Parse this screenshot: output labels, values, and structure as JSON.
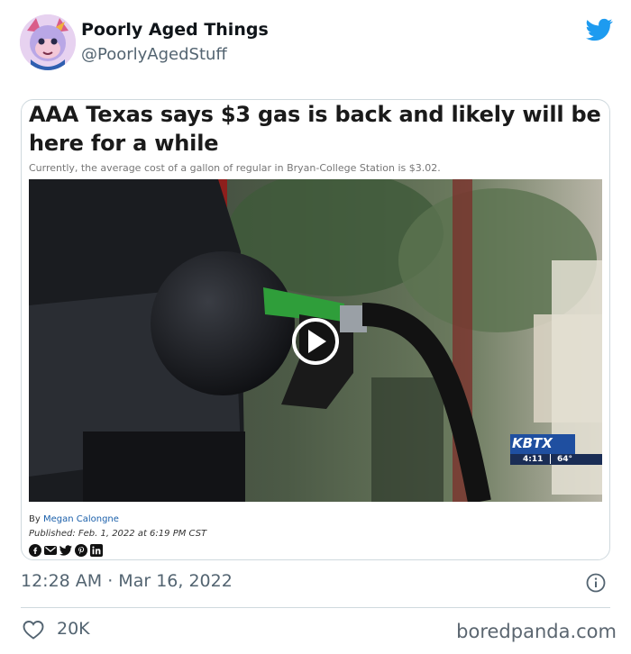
{
  "tweet": {
    "display_name": "Poorly Aged Things",
    "handle": "@PoorlyAgedStuff",
    "timestamp": "12:28 AM · Mar 16, 2022",
    "like_count": "20K"
  },
  "article": {
    "headline": "AAA Texas says $3 gas is back and likely will be here for a while",
    "subheadline": "Currently, the average cost of a gallon of regular in Bryan-College Station is $3.02.",
    "byline_prefix": "By ",
    "author": "Megan Calongne",
    "published": "Published: Feb. 1, 2022 at 6:19 PM CST",
    "share_icons": [
      "facebook-icon",
      "email-icon",
      "twitter-icon",
      "pinterest-icon",
      "linkedin-icon"
    ],
    "video": {
      "station_logo": "KBTX",
      "time": "4:11",
      "temperature": "64°"
    }
  },
  "watermark": "boredpanda.com",
  "colors": {
    "twitter_blue": "#1d9bf0",
    "text_secondary": "#536471",
    "border": "#cfd9de",
    "link": "#1a5faa"
  }
}
